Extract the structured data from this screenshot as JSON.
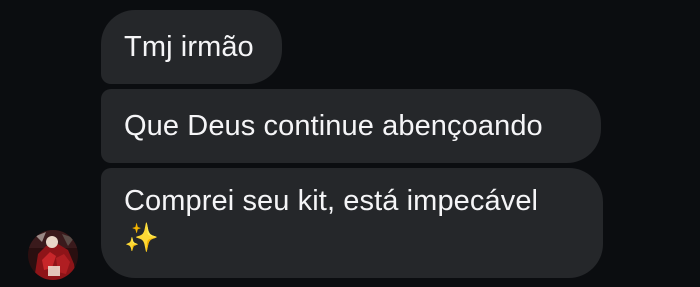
{
  "messages": [
    {
      "text": "Tmj irmão"
    },
    {
      "text": "Que Deus continue abençoando"
    },
    {
      "text": "Comprei seu kit, está impecável",
      "emoji": "✨"
    }
  ],
  "sender": {
    "avatar_icon": "profile-photo"
  },
  "colors": {
    "background": "#0b0d10",
    "bubble": "#25272a",
    "text": "#f5f5f7",
    "sparkle": "#f4c84a"
  }
}
